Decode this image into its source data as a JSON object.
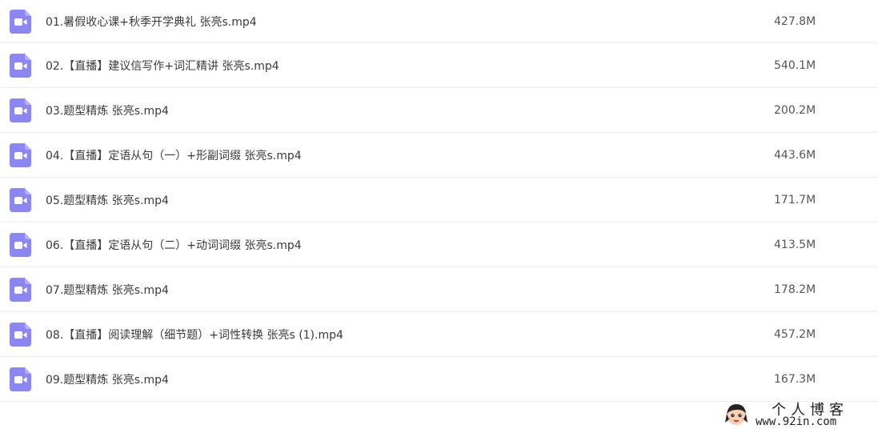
{
  "colors": {
    "icon_bg": "#8B86F0",
    "row_divider": "#eef0f3",
    "text": "#3a3a3a"
  },
  "files": [
    {
      "name": "01.暑假收心课+秋季开学典礼 张亮s.mp4",
      "size": "427.8M",
      "icon": "video-file-icon"
    },
    {
      "name": "02.【直播】建议信写作+词汇精讲 张亮s.mp4",
      "size": "540.1M",
      "icon": "video-file-icon"
    },
    {
      "name": "03.题型精炼 张亮s.mp4",
      "size": "200.2M",
      "icon": "video-file-icon"
    },
    {
      "name": "04.【直播】定语从句（一）+形副词缀 张亮s.mp4",
      "size": "443.6M",
      "icon": "video-file-icon"
    },
    {
      "name": "05.题型精炼 张亮s.mp4",
      "size": "171.7M",
      "icon": "video-file-icon"
    },
    {
      "name": "06.【直播】定语从句（二）+动词词缀 张亮s.mp4",
      "size": "413.5M",
      "icon": "video-file-icon"
    },
    {
      "name": "07.题型精炼 张亮s.mp4",
      "size": "178.2M",
      "icon": "video-file-icon"
    },
    {
      "name": "08.【直播】阅读理解（细节题）+词性转换 张亮s (1).mp4",
      "size": "457.2M",
      "icon": "video-file-icon"
    },
    {
      "name": "09.题型精炼 张亮s.mp4",
      "size": "167.3M",
      "icon": "video-file-icon"
    }
  ],
  "watermark": {
    "title": "个人博客",
    "url": "www.92in.com"
  }
}
